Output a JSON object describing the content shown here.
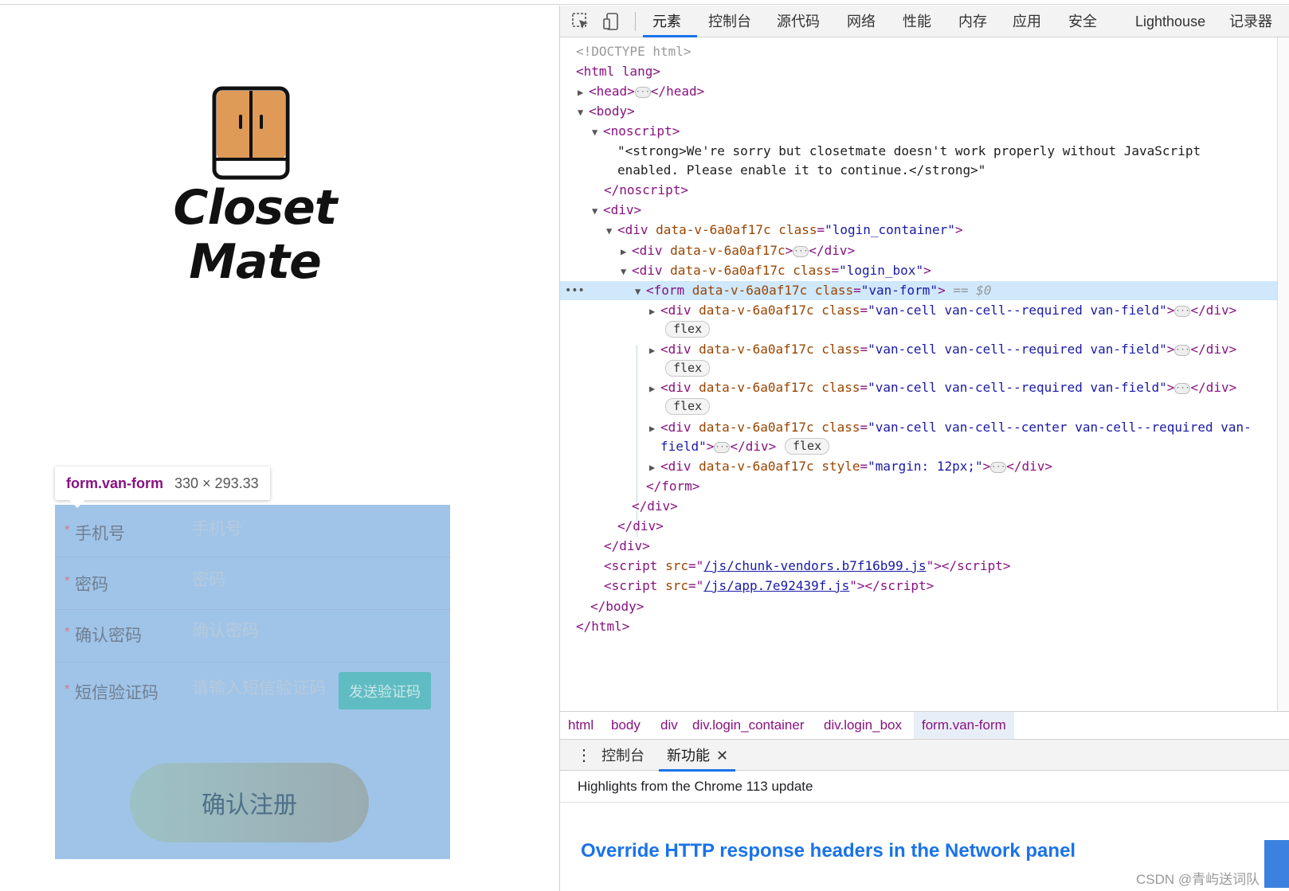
{
  "page": {
    "logo_line1": "Closet",
    "logo_line2": "Mate",
    "tooltip": {
      "element": "form.van-form",
      "size": "330 × 293.33"
    },
    "form": {
      "phone": {
        "label": "手机号",
        "placeholder": "手机号"
      },
      "password": {
        "label": "密码",
        "placeholder": "密码"
      },
      "confirm": {
        "label": "确认密码",
        "placeholder": "确认密码"
      },
      "sms": {
        "label": "短信验证码",
        "placeholder": "请输入短信验证码",
        "button": "发送验证码"
      },
      "required_mark": "*",
      "submit": "确认注册"
    }
  },
  "devtools": {
    "tabs": [
      "元素",
      "控制台",
      "源代码",
      "网络",
      "性能",
      "内存",
      "应用",
      "安全",
      "Lighthouse",
      "记录器"
    ],
    "active_tab": "元素",
    "dom": {
      "doctype": "<!DOCTYPE html>",
      "html_open": "<html lang>",
      "head": "<head>",
      "head_close": "</head>",
      "body": "<body>",
      "noscript": "<noscript>",
      "noscript_text1": "\"<strong>We're sorry but closetmate doesn't work properly without JavaScript",
      "noscript_text2": "enabled. Please enable it to continue.</strong>\"",
      "noscript_close": "</noscript>",
      "div": "<div>",
      "attr_scope": "data-v-6a0af17c",
      "class_login_container": "\"login_container\"",
      "class_login_box": "\"login_box\"",
      "class_van_form": "\"van-form\"",
      "class_field": "\"van-cell van-cell--required van-field\"",
      "class_center_a": "\"van-cell van-cell--center van-cell--required van-",
      "class_center_b": "field\"",
      "style_attr": "style",
      "style_val": "\"margin: 12px;\"",
      "selected_marker": "== $0",
      "flex": "flex",
      "form_close": "</form>",
      "div_close": "</div>",
      "script1": "/js/chunk-vendors.b7f16b99.js",
      "script2": "/js/app.7e92439f.js",
      "body_close": "</body>",
      "html_close": "</html>"
    },
    "breadcrumbs": [
      "html",
      "body",
      "div",
      "div.login_container",
      "div.login_box",
      "form.van-form"
    ],
    "drawer_tabs": [
      "控制台",
      "新功能"
    ],
    "active_drawer_tab": "新功能",
    "whats_new": {
      "subtitle": "Highlights from the Chrome 113 update",
      "headline": "Override HTTP response headers in the Network panel"
    }
  },
  "watermark": "CSDN @青屿送词队",
  "colors": {
    "overlay": "#a0c4e8",
    "tag": "#881280",
    "attr_name": "#994500",
    "attr_value": "#1a1aa6",
    "accent": "#1a73e8"
  }
}
